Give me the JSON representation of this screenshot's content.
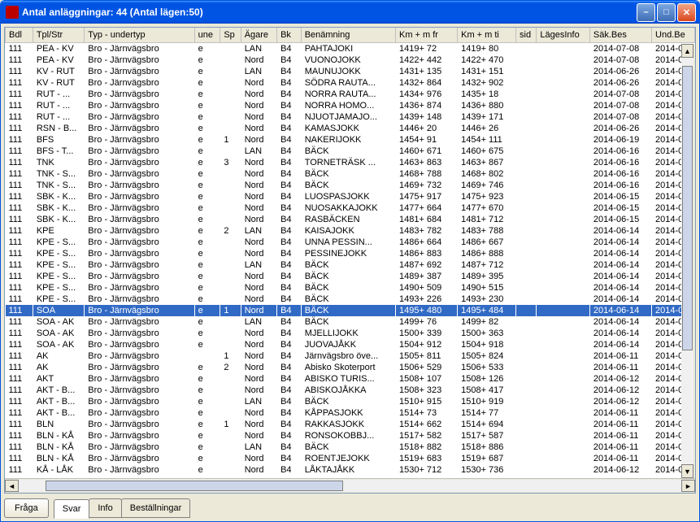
{
  "window": {
    "title": "Antal anläggningar: 44 (Antal lägen:50)"
  },
  "columns": [
    "Bdl",
    "Tpl/Str",
    "Typ - undertyp",
    "une",
    "Sp",
    "Ägare",
    "Bk",
    "Benämning",
    "Km + m fr",
    "Km + m ti",
    "sid",
    "LägesInfo",
    "Säk.Bes",
    "Und.Be"
  ],
  "rows": [
    {
      "bdl": "111",
      "tpl": "PEA - KV",
      "typ": "Bro - Järnvägsbro",
      "une": "e",
      "sp": "",
      "agare": "LAN",
      "bk": "B4",
      "ben": "PAHTAJOKI",
      "kmfr": "1419+ 72",
      "kmti": "1419+ 80",
      "sid": "",
      "lag": "",
      "sak": "2014-07-08",
      "und": "2014-0"
    },
    {
      "bdl": "111",
      "tpl": "PEA - KV",
      "typ": "Bro - Järnvägsbro",
      "une": "e",
      "sp": "",
      "agare": "Nord",
      "bk": "B4",
      "ben": "VUONOJOKK",
      "kmfr": "1422+ 442",
      "kmti": "1422+ 470",
      "sid": "",
      "lag": "",
      "sak": "2014-07-08",
      "und": "2014-0"
    },
    {
      "bdl": "111",
      "tpl": "KV - RUT",
      "typ": "Bro - Järnvägsbro",
      "une": "e",
      "sp": "",
      "agare": "LAN",
      "bk": "B4",
      "ben": "MAUNUJOKK",
      "kmfr": "1431+ 135",
      "kmti": "1431+ 151",
      "sid": "",
      "lag": "",
      "sak": "2014-06-26",
      "und": "2014-0"
    },
    {
      "bdl": "111",
      "tpl": "KV - RUT",
      "typ": "Bro - Järnvägsbro",
      "une": "e",
      "sp": "",
      "agare": "Nord",
      "bk": "B4",
      "ben": "SÖDRA RAUTA...",
      "kmfr": "1432+ 864",
      "kmti": "1432+ 902",
      "sid": "",
      "lag": "",
      "sak": "2014-06-26",
      "und": "2014-0"
    },
    {
      "bdl": "111",
      "tpl": "RUT - ...",
      "typ": "Bro - Järnvägsbro",
      "une": "e",
      "sp": "",
      "agare": "Nord",
      "bk": "B4",
      "ben": "NORRA RAUTA...",
      "kmfr": "1434+ 976",
      "kmti": "1435+ 18",
      "sid": "",
      "lag": "",
      "sak": "2014-07-08",
      "und": "2014-0"
    },
    {
      "bdl": "111",
      "tpl": "RUT - ...",
      "typ": "Bro - Järnvägsbro",
      "une": "e",
      "sp": "",
      "agare": "Nord",
      "bk": "B4",
      "ben": "NORRA HOMO...",
      "kmfr": "1436+ 874",
      "kmti": "1436+ 880",
      "sid": "",
      "lag": "",
      "sak": "2014-07-08",
      "und": "2014-0"
    },
    {
      "bdl": "111",
      "tpl": "RUT - ...",
      "typ": "Bro - Järnvägsbro",
      "une": "e",
      "sp": "",
      "agare": "Nord",
      "bk": "B4",
      "ben": "NJUOTJAMAJO...",
      "kmfr": "1439+ 148",
      "kmti": "1439+ 171",
      "sid": "",
      "lag": "",
      "sak": "2014-07-08",
      "und": "2014-0"
    },
    {
      "bdl": "111",
      "tpl": "RSN - B...",
      "typ": "Bro - Järnvägsbro",
      "une": "e",
      "sp": "",
      "agare": "Nord",
      "bk": "B4",
      "ben": "KAMASJOKK",
      "kmfr": "1446+ 20",
      "kmti": "1446+ 26",
      "sid": "",
      "lag": "",
      "sak": "2014-06-26",
      "und": "2014-0"
    },
    {
      "bdl": "111",
      "tpl": "BFS",
      "typ": "Bro - Järnvägsbro",
      "une": "e",
      "sp": "1",
      "agare": "Nord",
      "bk": "B4",
      "ben": "NAKERIJOKK",
      "kmfr": "1454+ 91",
      "kmti": "1454+ 111",
      "sid": "",
      "lag": "",
      "sak": "2014-06-19",
      "und": "2014-0"
    },
    {
      "bdl": "111",
      "tpl": "BFS - T...",
      "typ": "Bro - Järnvägsbro",
      "une": "e",
      "sp": "",
      "agare": "LAN",
      "bk": "B4",
      "ben": "BÄCK",
      "kmfr": "1460+ 671",
      "kmti": "1460+ 675",
      "sid": "",
      "lag": "",
      "sak": "2014-06-16",
      "und": "2014-0"
    },
    {
      "bdl": "111",
      "tpl": "TNK",
      "typ": "Bro - Järnvägsbro",
      "une": "e",
      "sp": "3",
      "agare": "Nord",
      "bk": "B4",
      "ben": "TORNETRÄSK ...",
      "kmfr": "1463+ 863",
      "kmti": "1463+ 867",
      "sid": "",
      "lag": "",
      "sak": "2014-06-16",
      "und": "2014-0"
    },
    {
      "bdl": "111",
      "tpl": "TNK - S...",
      "typ": "Bro - Järnvägsbro",
      "une": "e",
      "sp": "",
      "agare": "Nord",
      "bk": "B4",
      "ben": "BÄCK",
      "kmfr": "1468+ 788",
      "kmti": "1468+ 802",
      "sid": "",
      "lag": "",
      "sak": "2014-06-16",
      "und": "2014-0"
    },
    {
      "bdl": "111",
      "tpl": "TNK - S...",
      "typ": "Bro - Järnvägsbro",
      "une": "e",
      "sp": "",
      "agare": "Nord",
      "bk": "B4",
      "ben": "BÄCK",
      "kmfr": "1469+ 732",
      "kmti": "1469+ 746",
      "sid": "",
      "lag": "",
      "sak": "2014-06-16",
      "und": "2014-0"
    },
    {
      "bdl": "111",
      "tpl": "SBK - K...",
      "typ": "Bro - Järnvägsbro",
      "une": "e",
      "sp": "",
      "agare": "Nord",
      "bk": "B4",
      "ben": "LUOSPASJOKK",
      "kmfr": "1475+ 917",
      "kmti": "1475+ 923",
      "sid": "",
      "lag": "",
      "sak": "2014-06-15",
      "und": "2014-0"
    },
    {
      "bdl": "111",
      "tpl": "SBK - K...",
      "typ": "Bro - Järnvägsbro",
      "une": "e",
      "sp": "",
      "agare": "Nord",
      "bk": "B4",
      "ben": "NUOSAKKAJOKK",
      "kmfr": "1477+ 664",
      "kmti": "1477+ 670",
      "sid": "",
      "lag": "",
      "sak": "2014-06-15",
      "und": "2014-0"
    },
    {
      "bdl": "111",
      "tpl": "SBK - K...",
      "typ": "Bro - Järnvägsbro",
      "une": "e",
      "sp": "",
      "agare": "Nord",
      "bk": "B4",
      "ben": "RASBÄCKEN",
      "kmfr": "1481+ 684",
      "kmti": "1481+ 712",
      "sid": "",
      "lag": "",
      "sak": "2014-06-15",
      "und": "2014-0"
    },
    {
      "bdl": "111",
      "tpl": "KPE",
      "typ": "Bro - Järnvägsbro",
      "une": "e",
      "sp": "2",
      "agare": "LAN",
      "bk": "B4",
      "ben": "KAISAJOKK",
      "kmfr": "1483+ 782",
      "kmti": "1483+ 788",
      "sid": "",
      "lag": "",
      "sak": "2014-06-14",
      "und": "2014-0"
    },
    {
      "bdl": "111",
      "tpl": "KPE - S...",
      "typ": "Bro - Järnvägsbro",
      "une": "e",
      "sp": "",
      "agare": "Nord",
      "bk": "B4",
      "ben": "UNNA PESSIN...",
      "kmfr": "1486+ 664",
      "kmti": "1486+ 667",
      "sid": "",
      "lag": "",
      "sak": "2014-06-14",
      "und": "2014-0"
    },
    {
      "bdl": "111",
      "tpl": "KPE - S...",
      "typ": "Bro - Järnvägsbro",
      "une": "e",
      "sp": "",
      "agare": "Nord",
      "bk": "B4",
      "ben": "PESSINEJOKK",
      "kmfr": "1486+ 883",
      "kmti": "1486+ 888",
      "sid": "",
      "lag": "",
      "sak": "2014-06-14",
      "und": "2014-0"
    },
    {
      "bdl": "111",
      "tpl": "KPE - S...",
      "typ": "Bro - Järnvägsbro",
      "une": "e",
      "sp": "",
      "agare": "LAN",
      "bk": "B4",
      "ben": "BÄCK",
      "kmfr": "1487+ 692",
      "kmti": "1487+ 712",
      "sid": "",
      "lag": "",
      "sak": "2014-06-14",
      "und": "2014-0"
    },
    {
      "bdl": "111",
      "tpl": "KPE - S...",
      "typ": "Bro - Järnvägsbro",
      "une": "e",
      "sp": "",
      "agare": "Nord",
      "bk": "B4",
      "ben": "BÄCK",
      "kmfr": "1489+ 387",
      "kmti": "1489+ 395",
      "sid": "",
      "lag": "",
      "sak": "2014-06-14",
      "und": "2014-0"
    },
    {
      "bdl": "111",
      "tpl": "KPE - S...",
      "typ": "Bro - Järnvägsbro",
      "une": "e",
      "sp": "",
      "agare": "Nord",
      "bk": "B4",
      "ben": "BÄCK",
      "kmfr": "1490+ 509",
      "kmti": "1490+ 515",
      "sid": "",
      "lag": "",
      "sak": "2014-06-14",
      "und": "2014-0"
    },
    {
      "bdl": "111",
      "tpl": "KPE - S...",
      "typ": "Bro - Järnvägsbro",
      "une": "e",
      "sp": "",
      "agare": "Nord",
      "bk": "B4",
      "ben": "BÄCK",
      "kmfr": "1493+ 226",
      "kmti": "1493+ 230",
      "sid": "",
      "lag": "",
      "sak": "2014-06-14",
      "und": "2014-0"
    },
    {
      "bdl": "111",
      "tpl": "SOA",
      "typ": "Bro - Järnvägsbro",
      "une": "e",
      "sp": "1",
      "agare": "Nord",
      "bk": "B4",
      "ben": "BÄCK",
      "kmfr": "1495+ 480",
      "kmti": "1495+ 484",
      "sid": "",
      "lag": "",
      "sak": "2014-06-14",
      "und": "2014-0",
      "selected": true
    },
    {
      "bdl": "111",
      "tpl": "SOA - AK",
      "typ": "Bro - Järnvägsbro",
      "une": "e",
      "sp": "",
      "agare": "LAN",
      "bk": "B4",
      "ben": "BÄCK",
      "kmfr": "1499+ 76",
      "kmti": "1499+ 82",
      "sid": "",
      "lag": "",
      "sak": "2014-06-14",
      "und": "2014-0"
    },
    {
      "bdl": "111",
      "tpl": "SOA - AK",
      "typ": "Bro - Järnvägsbro",
      "une": "e",
      "sp": "",
      "agare": "Nord",
      "bk": "B4",
      "ben": "MJELLIJOKK",
      "kmfr": "1500+ 339",
      "kmti": "1500+ 363",
      "sid": "",
      "lag": "",
      "sak": "2014-06-14",
      "und": "2014-0"
    },
    {
      "bdl": "111",
      "tpl": "SOA - AK",
      "typ": "Bro - Järnvägsbro",
      "une": "e",
      "sp": "",
      "agare": "Nord",
      "bk": "B4",
      "ben": "JUOVAJÅKK",
      "kmfr": "1504+ 912",
      "kmti": "1504+ 918",
      "sid": "",
      "lag": "",
      "sak": "2014-06-14",
      "und": "2014-0"
    },
    {
      "bdl": "111",
      "tpl": "AK",
      "typ": "Bro - Järnvägsbro",
      "une": "",
      "sp": "1",
      "agare": "Nord",
      "bk": "B4",
      "ben": "Järnvägsbro öve...",
      "kmfr": "1505+ 811",
      "kmti": "1505+ 824",
      "sid": "",
      "lag": "",
      "sak": "2014-06-11",
      "und": "2014-0"
    },
    {
      "bdl": "111",
      "tpl": "AK",
      "typ": "Bro - Järnvägsbro",
      "une": "e",
      "sp": "2",
      "agare": "Nord",
      "bk": "B4",
      "ben": "Abisko Skoterport",
      "kmfr": "1506+ 529",
      "kmti": "1506+ 533",
      "sid": "",
      "lag": "",
      "sak": "2014-06-11",
      "und": "2014-0"
    },
    {
      "bdl": "111",
      "tpl": "AKT",
      "typ": "Bro - Järnvägsbro",
      "une": "e",
      "sp": "",
      "agare": "Nord",
      "bk": "B4",
      "ben": "ABISKO TURIS...",
      "kmfr": "1508+ 107",
      "kmti": "1508+ 126",
      "sid": "",
      "lag": "",
      "sak": "2014-06-12",
      "und": "2014-0"
    },
    {
      "bdl": "111",
      "tpl": "AKT - B...",
      "typ": "Bro - Järnvägsbro",
      "une": "e",
      "sp": "",
      "agare": "Nord",
      "bk": "B4",
      "ben": "ABISKOJÅKKA",
      "kmfr": "1508+ 323",
      "kmti": "1508+ 417",
      "sid": "",
      "lag": "",
      "sak": "2014-06-12",
      "und": "2014-0"
    },
    {
      "bdl": "111",
      "tpl": "AKT - B...",
      "typ": "Bro - Järnvägsbro",
      "une": "e",
      "sp": "",
      "agare": "LAN",
      "bk": "B4",
      "ben": "BÄCK",
      "kmfr": "1510+ 915",
      "kmti": "1510+ 919",
      "sid": "",
      "lag": "",
      "sak": "2014-06-12",
      "und": "2014-0"
    },
    {
      "bdl": "111",
      "tpl": "AKT - B...",
      "typ": "Bro - Järnvägsbro",
      "une": "e",
      "sp": "",
      "agare": "Nord",
      "bk": "B4",
      "ben": "KÅPPASJOKK",
      "kmfr": "1514+ 73",
      "kmti": "1514+ 77",
      "sid": "",
      "lag": "",
      "sak": "2014-06-11",
      "und": "2014-0"
    },
    {
      "bdl": "111",
      "tpl": "BLN",
      "typ": "Bro - Järnvägsbro",
      "une": "e",
      "sp": "1",
      "agare": "Nord",
      "bk": "B4",
      "ben": "RAKKASJOKK",
      "kmfr": "1514+ 662",
      "kmti": "1514+ 694",
      "sid": "",
      "lag": "",
      "sak": "2014-06-11",
      "und": "2014-0"
    },
    {
      "bdl": "111",
      "tpl": "BLN - KÅ",
      "typ": "Bro - Järnvägsbro",
      "une": "e",
      "sp": "",
      "agare": "Nord",
      "bk": "B4",
      "ben": "RONSOKOBBJ...",
      "kmfr": "1517+ 582",
      "kmti": "1517+ 587",
      "sid": "",
      "lag": "",
      "sak": "2014-06-11",
      "und": "2014-0"
    },
    {
      "bdl": "111",
      "tpl": "BLN - KÅ",
      "typ": "Bro - Järnvägsbro",
      "une": "e",
      "sp": "",
      "agare": "LAN",
      "bk": "B4",
      "ben": "BÄCK",
      "kmfr": "1518+ 882",
      "kmti": "1518+ 886",
      "sid": "",
      "lag": "",
      "sak": "2014-06-11",
      "und": "2014-0"
    },
    {
      "bdl": "111",
      "tpl": "BLN - KÅ",
      "typ": "Bro - Järnvägsbro",
      "une": "e",
      "sp": "",
      "agare": "Nord",
      "bk": "B4",
      "ben": "ROENTJEJOKK",
      "kmfr": "1519+ 683",
      "kmti": "1519+ 687",
      "sid": "",
      "lag": "",
      "sak": "2014-06-11",
      "und": "2014-0"
    },
    {
      "bdl": "111",
      "tpl": "KÅ - LÅK",
      "typ": "Bro - Järnvägsbro",
      "une": "e",
      "sp": "",
      "agare": "Nord",
      "bk": "B4",
      "ben": "LÅKTAJÅKK",
      "kmfr": "1530+ 712",
      "kmti": "1530+ 736",
      "sid": "",
      "lag": "",
      "sak": "2014-06-12",
      "und": "2014-0"
    }
  ],
  "tabs": {
    "fraga": "Fråga",
    "svar": "Svar",
    "info": "Info",
    "bestall": "Beställningar",
    "active": "svar"
  }
}
